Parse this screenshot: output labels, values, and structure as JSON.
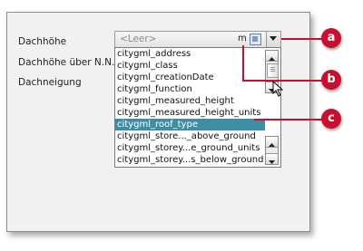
{
  "form": {
    "labels": {
      "dachhoehe": "Dachhöhe",
      "dachhoehe_nn": "Dachhöhe über N.N.",
      "dachneigung": "Dachneigung"
    },
    "combo": {
      "placeholder": "<Leer>",
      "unit": "m"
    },
    "dropdown": {
      "items": [
        "citygml_address",
        "citygml_class",
        "citygml_creationDate",
        "citygml_function",
        "citygml_measured_height",
        "citygml_measured_height_units",
        "citygml_roof_type",
        "citygml_store..._above_ground",
        "citygml_storey...e_ground_units",
        "citygml_storey...s_below_ground"
      ],
      "selected": "citygml_roof_type"
    }
  },
  "callouts": {
    "a": "a",
    "b": "b",
    "c": "c"
  },
  "colors": {
    "accent": "#c8102e",
    "selection": "#3d8ea4"
  }
}
